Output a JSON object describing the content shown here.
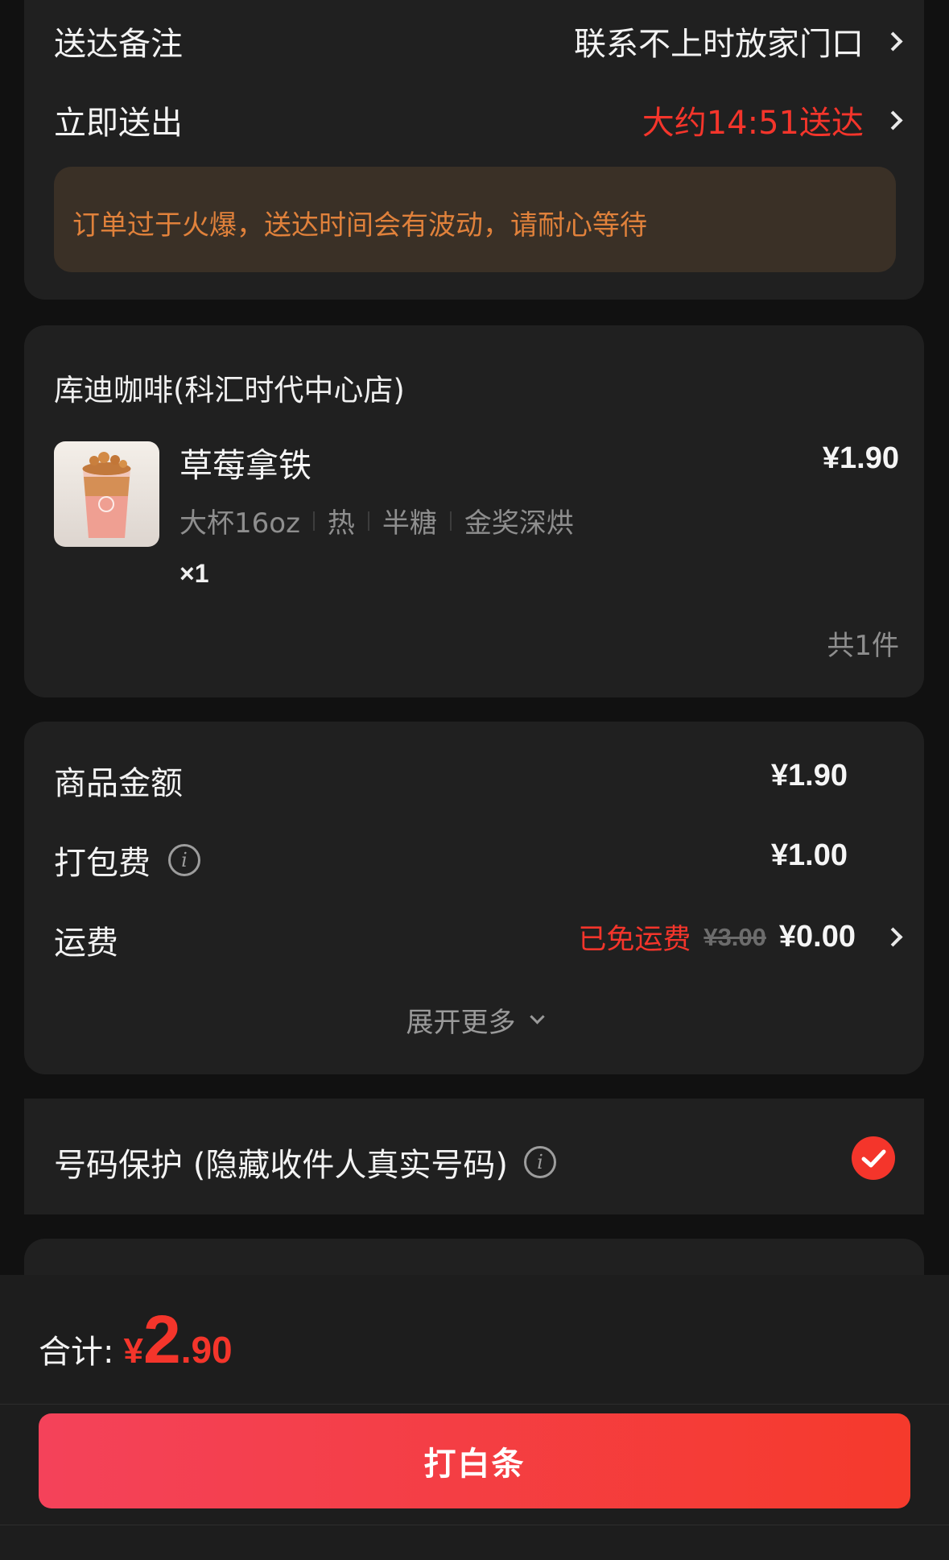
{
  "delivery": {
    "note_label": "送达备注",
    "note_value": "联系不上时放家门口",
    "time_label": "立即送出",
    "time_value": "大约14:51送达",
    "warning": "订单过于火爆，送达时间会有波动，请耐心等待"
  },
  "store": {
    "name": "库迪咖啡(科汇时代中心店)",
    "item": {
      "name": "草莓拿铁",
      "price": "¥1.90",
      "specs": [
        "大杯16oz",
        "热",
        "半糖",
        "金奖深烘"
      ],
      "qty": "×1"
    },
    "total_count": "共1件"
  },
  "fees": {
    "goods_label": "商品金额",
    "goods_value": "¥1.90",
    "packing_label": "打包费",
    "packing_value": "¥1.00",
    "shipping_label": "运费",
    "shipping_free": "已免运费",
    "shipping_original": "¥3.00",
    "shipping_value": "¥0.00",
    "expand": "展开更多"
  },
  "privacy": {
    "label": "号码保护 (隐藏收件人真实号码)",
    "checked": true
  },
  "footer": {
    "total_label": "合计:",
    "currency": "¥",
    "amount_int": "2",
    "amount_dec": ".90",
    "submit": "打白条"
  },
  "colors": {
    "accent": "#f4352b",
    "warning_text": "#e0813b",
    "warning_bg": "#3a3026"
  }
}
